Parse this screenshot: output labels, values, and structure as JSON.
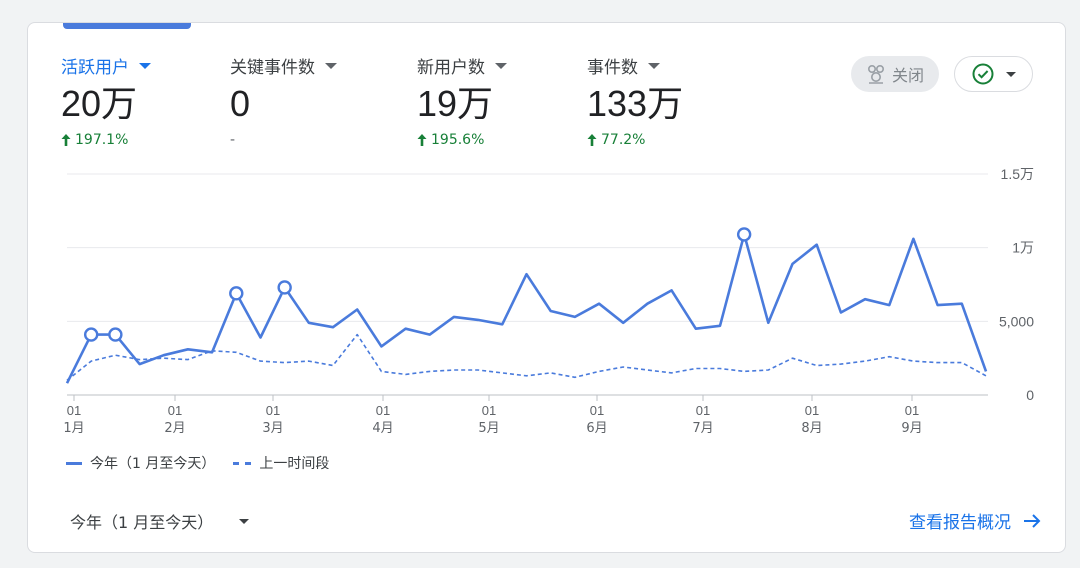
{
  "metrics": [
    {
      "label": "活跃用户",
      "value": "20万",
      "change": "197.1%",
      "trend": "up",
      "active": true
    },
    {
      "label": "关键事件数",
      "value": "0",
      "change": "-",
      "trend": "none",
      "active": false
    },
    {
      "label": "新用户数",
      "value": "19万",
      "change": "195.6%",
      "trend": "up",
      "active": false
    },
    {
      "label": "事件数",
      "value": "133万",
      "change": "77.2%",
      "trend": "up",
      "active": false
    }
  ],
  "toolbar": {
    "close_label": "关闭",
    "close_icon": "insights-off-icon",
    "status_icon": "check-circle-icon"
  },
  "colors": {
    "accent": "#1a73e8",
    "series": "#4a7bdc",
    "positive": "#188038"
  },
  "chart_data": {
    "type": "line",
    "y_ticks": [
      "1.5万",
      "1万",
      "5,000",
      "0"
    ],
    "ylim": [
      0,
      15000
    ],
    "x_ticks": [
      {
        "day": "01",
        "month": "1月"
      },
      {
        "day": "01",
        "month": "2月"
      },
      {
        "day": "01",
        "month": "3月"
      },
      {
        "day": "01",
        "month": "4月"
      },
      {
        "day": "01",
        "month": "5月"
      },
      {
        "day": "01",
        "month": "6月"
      },
      {
        "day": "01",
        "month": "7月"
      },
      {
        "day": "01",
        "month": "8月"
      },
      {
        "day": "01",
        "month": "9月"
      }
    ],
    "grid": true,
    "series": [
      {
        "name": "今年（1 月至今天）",
        "style": "solid",
        "values": [
          800,
          4100,
          4100,
          2100,
          2700,
          3100,
          2900,
          6900,
          3900,
          7300,
          4900,
          4600,
          5800,
          3300,
          4500,
          4100,
          5300,
          5100,
          4800,
          8200,
          5700,
          5300,
          6200,
          4900,
          6200,
          7100,
          4500,
          4700,
          10900,
          4900,
          8900,
          10200,
          5600,
          6500,
          6100,
          10600,
          6100,
          6200,
          1600
        ],
        "markers": [
          1,
          2,
          7,
          9,
          28
        ]
      },
      {
        "name": "上一时间段",
        "style": "dashed",
        "values": [
          1000,
          2300,
          2700,
          2400,
          2500,
          2400,
          3000,
          2900,
          2300,
          2200,
          2300,
          2000,
          4100,
          1600,
          1400,
          1600,
          1700,
          1700,
          1500,
          1300,
          1500,
          1200,
          1600,
          1900,
          1700,
          1500,
          1800,
          1800,
          1600,
          1700,
          2500,
          2000,
          2100,
          2300,
          2600,
          2300,
          2200,
          2200,
          1300
        ]
      }
    ]
  },
  "legend": {
    "current": "今年（1 月至今天）",
    "previous": "上一时间段"
  },
  "footer": {
    "range_label": "今年（1 月至今天）",
    "report_link": "查看报告概况",
    "report_arrow": "arrow-right-icon"
  }
}
